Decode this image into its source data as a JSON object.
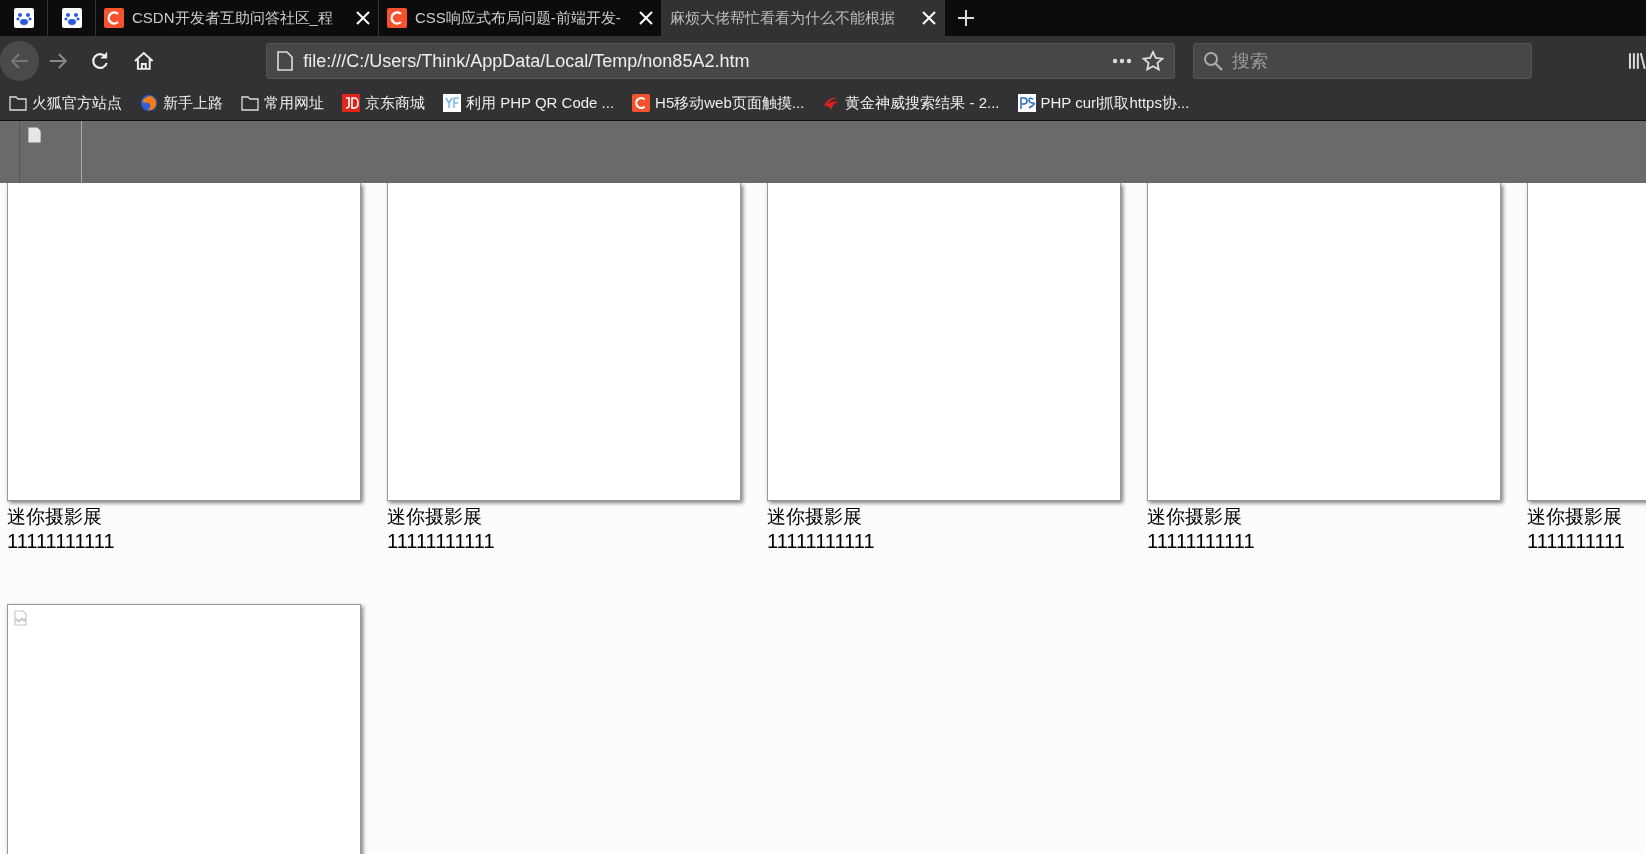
{
  "tabs": [
    {
      "selected": false
    },
    {
      "selected": false
    },
    {
      "title": "CSDN开发者互助问答社区_程",
      "selected": false
    },
    {
      "title": "CSS响应式布局问题-前端开发-",
      "selected": false
    },
    {
      "title": "麻烦大佬帮忙看看为什么不能根据",
      "selected": true
    }
  ],
  "address": {
    "url": "file:///C:/Users/Think/AppData/Local/Temp/non85A2.htm"
  },
  "search": {
    "placeholder": "搜索"
  },
  "bookmarks": [
    {
      "label": "火狐官方站点"
    },
    {
      "label": "新手上路"
    },
    {
      "label": "常用网址"
    },
    {
      "label": "京东商城"
    },
    {
      "label": "利用 PHP QR Code ..."
    },
    {
      "label": "H5移动web页面触摸..."
    },
    {
      "label": "黄金神威搜索结果 - 2..."
    },
    {
      "label": "PHP curl抓取https协..."
    }
  ],
  "cards": [
    {
      "title": "迷你摄影展",
      "caption": "11111111111",
      "broken_image": false
    },
    {
      "title": "迷你摄影展",
      "caption": "11111111111",
      "broken_image": false
    },
    {
      "title": "迷你摄影展",
      "caption": "11111111111",
      "broken_image": false
    },
    {
      "title": "迷你摄影展",
      "caption": "11111111111",
      "broken_image": false
    },
    {
      "title": "迷你摄影展",
      "caption": "1111111111",
      "broken_image": false
    },
    {
      "broken_image": true
    }
  ]
}
